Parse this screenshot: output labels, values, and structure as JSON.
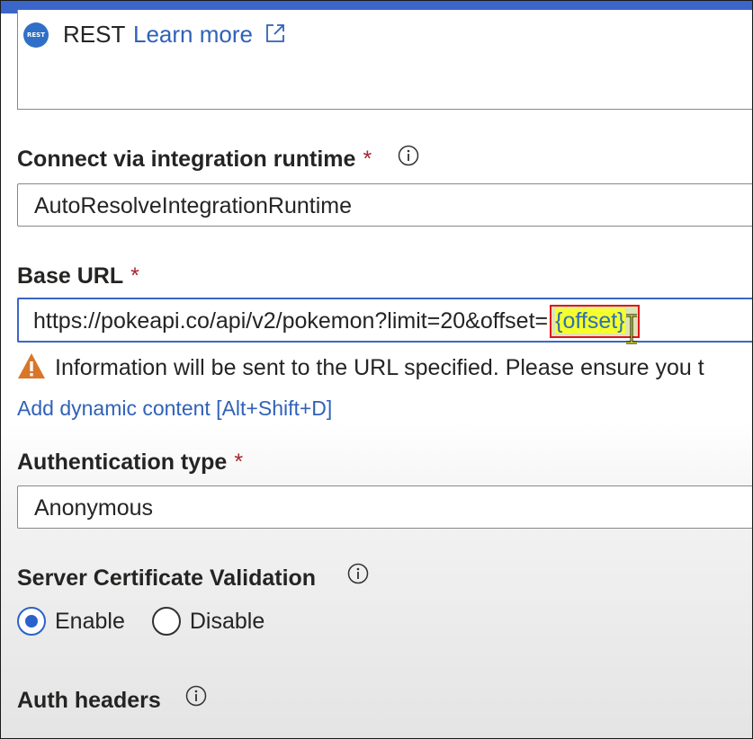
{
  "accent_color": "#3b66c9",
  "connector": {
    "icon": "rest-icon",
    "icon_text": "REST",
    "name": "REST",
    "learn_more_label": "Learn more"
  },
  "integration_runtime": {
    "label": "Connect via integration runtime",
    "required_marker": "*",
    "value": "AutoResolveIntegrationRuntime"
  },
  "base_url": {
    "label": "Base URL",
    "required_marker": "*",
    "value_prefix": "https://pokeapi.co/api/v2/pokemon?limit=20&offset=",
    "value_highlight": "{offset}",
    "warning": "Information will be sent to the URL specified. Please ensure you t",
    "dynamic_content_link": "Add dynamic content [Alt+Shift+D]"
  },
  "authentication": {
    "label": "Authentication type",
    "required_marker": "*",
    "value": "Anonymous"
  },
  "server_certificate": {
    "label": "Server Certificate Validation",
    "options": [
      {
        "label": "Enable",
        "checked": true
      },
      {
        "label": "Disable",
        "checked": false
      }
    ]
  },
  "auth_headers": {
    "label": "Auth headers"
  }
}
